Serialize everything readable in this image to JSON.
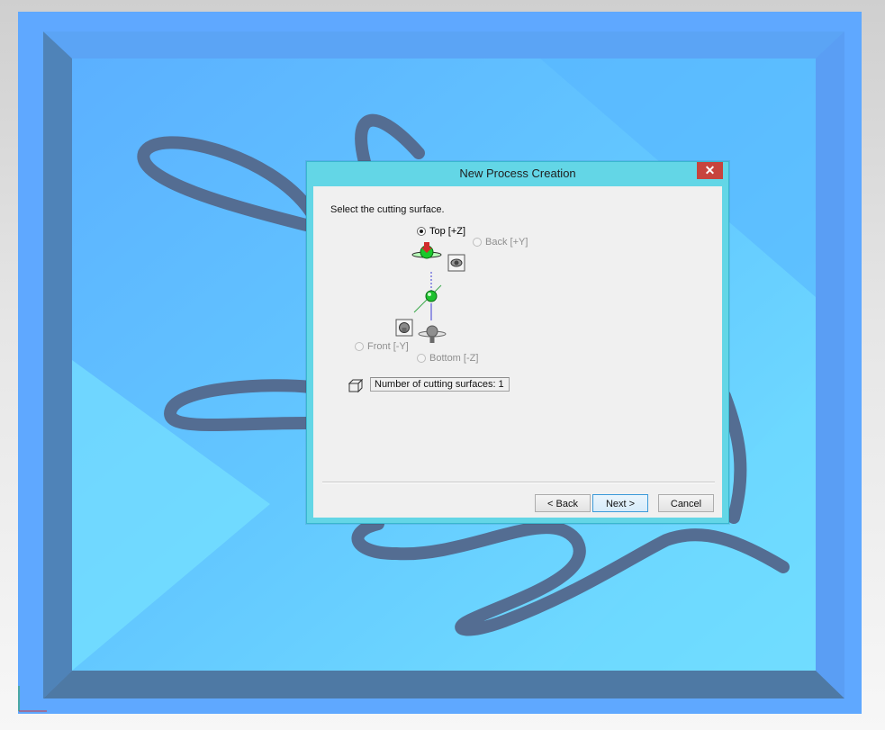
{
  "dialog": {
    "title": "New Process Creation",
    "close_label": "✕",
    "instruction": "Select the cutting surface.",
    "options": {
      "top": {
        "label": "Top [+Z]",
        "checked": true,
        "enabled": true
      },
      "back": {
        "label": "Back [+Y]",
        "checked": false,
        "enabled": false
      },
      "front": {
        "label": "Front [-Y]",
        "checked": false,
        "enabled": false
      },
      "bottom": {
        "label": "Bottom [-Z]",
        "checked": false,
        "enabled": false
      }
    },
    "count_label": "Number of cutting surfaces: 1",
    "buttons": {
      "back": "< Back",
      "next": "Next >",
      "cancel": "Cancel"
    }
  },
  "icons": {
    "close": "close-icon",
    "top_view": "top-surface-icon",
    "back_view": "back-view-icon",
    "front_view": "front-view-icon",
    "bottom_view": "bottom-surface-icon",
    "origin": "origin-sphere-icon",
    "count": "cube-outline-icon"
  },
  "colors": {
    "dialog_frame": "#63d6e6",
    "close_button": "#c7443d",
    "client_bg": "#f0f0f0",
    "workpiece_blue": "#5aa8ff",
    "workpiece_cyan": "#6fdcff"
  }
}
